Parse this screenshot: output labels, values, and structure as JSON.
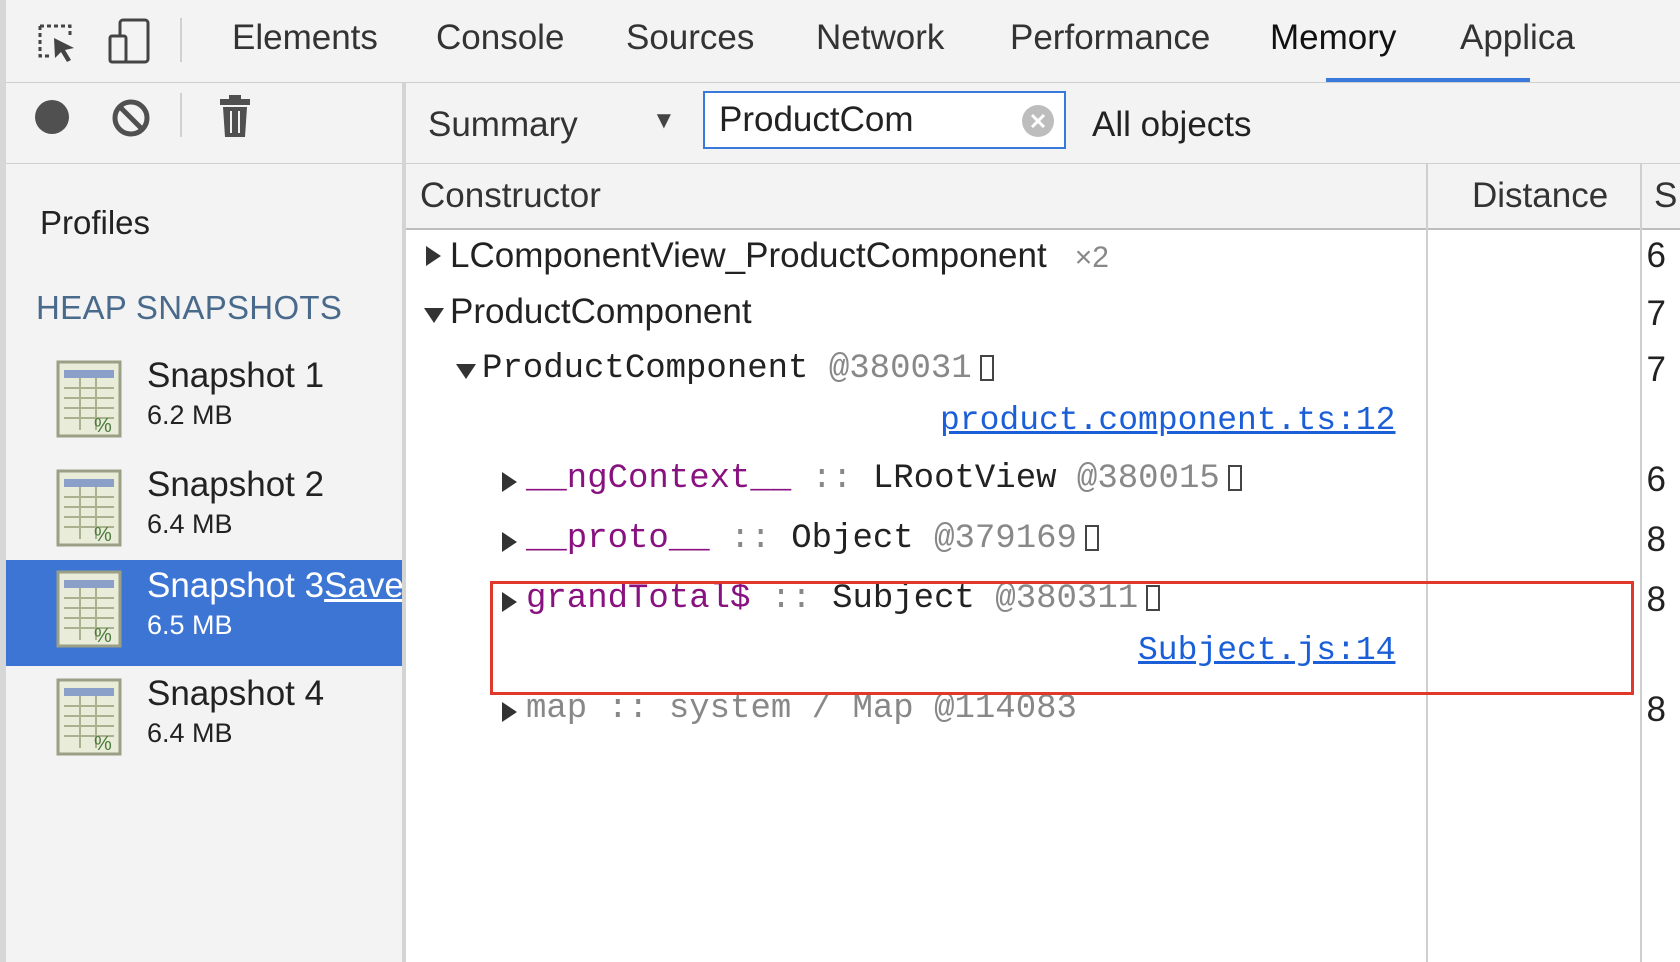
{
  "tabs": [
    {
      "label": "Elements"
    },
    {
      "label": "Console"
    },
    {
      "label": "Sources"
    },
    {
      "label": "Network"
    },
    {
      "label": "Performance"
    },
    {
      "label": "Memory"
    },
    {
      "label": "Applica"
    }
  ],
  "active_tab": "Memory",
  "sidebar": {
    "profiles_label": "Profiles",
    "heap_heading": "HEAP SNAPSHOTS",
    "snapshots": [
      {
        "name": "Snapshot 1",
        "size": "6.2 MB"
      },
      {
        "name": "Snapshot 2",
        "size": "6.4 MB"
      },
      {
        "name": "Snapshot 3",
        "save": "Save",
        "size": "6.5 MB",
        "selected": true
      },
      {
        "name": "Snapshot 4",
        "size": "6.4 MB"
      }
    ]
  },
  "toolbar": {
    "view_select": "Summary",
    "filter_value": "ProductCom",
    "scope_label": "All objects"
  },
  "grid": {
    "headers": {
      "constructor": "Constructor",
      "distance": "Distance",
      "shallow": "S"
    },
    "rows": [
      {
        "name": "LComponentView_ProductComponent",
        "count": "×2",
        "distance": "6"
      },
      {
        "name": "ProductComponent",
        "distance": "7"
      },
      {
        "name": "ProductComponent",
        "id": "@380031",
        "distance": "7",
        "link": "product.component.ts:12"
      },
      {
        "prop": "__ngContext__",
        "sep": " :: ",
        "type": "LRootView",
        "id": "@380015",
        "distance": "6"
      },
      {
        "prop": "__proto__",
        "sep": " :: ",
        "type": "Object",
        "id": "@379169",
        "distance": "8"
      },
      {
        "prop": "grandTotal$",
        "sep": " :: ",
        "type": "Subject",
        "id": "@380311",
        "distance": "8",
        "link": "Subject.js:14"
      },
      {
        "prop": "map",
        "sep": " :: ",
        "type": "system / Map",
        "id": "@114083",
        "distance": "8"
      }
    ]
  },
  "colors": {
    "accent": "#3879d9",
    "selected_bg": "#3d75d4",
    "highlight": "#e0392b",
    "purple": "#881280",
    "link": "#1a5fd8"
  }
}
